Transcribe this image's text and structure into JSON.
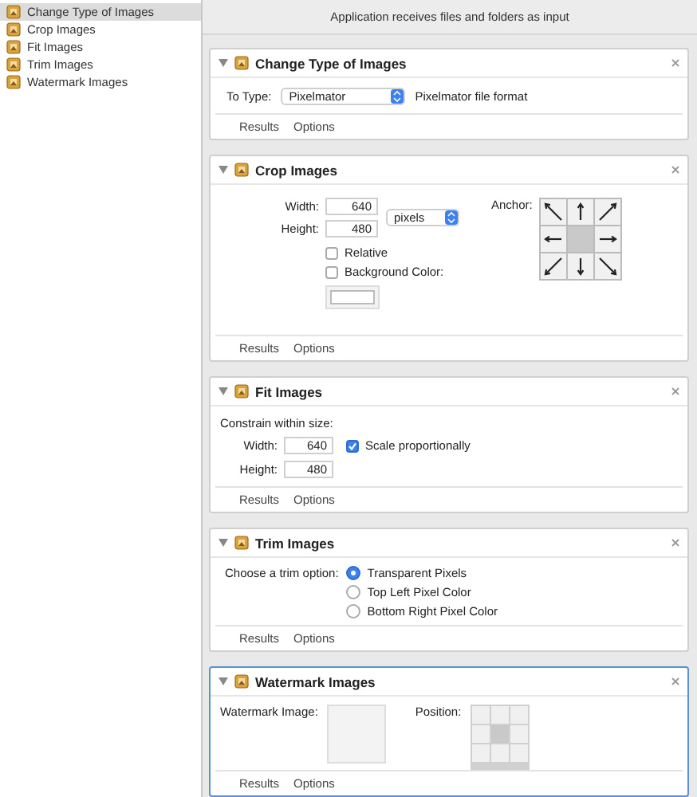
{
  "sidebar": {
    "items": [
      {
        "label": "Change Type of Images",
        "selected": true
      },
      {
        "label": "Crop Images",
        "selected": false
      },
      {
        "label": "Fit Images",
        "selected": false
      },
      {
        "label": "Trim Images",
        "selected": false
      },
      {
        "label": "Watermark Images",
        "selected": false
      }
    ]
  },
  "workflow_header": "Application receives files and folders as input",
  "actions": [
    {
      "kind": "change_type",
      "title": "Change Type of Images",
      "selected": false,
      "to_type_label": "To Type:",
      "to_type_value": "Pixelmator",
      "description": "Pixelmator file format",
      "footer_tabs": [
        "Results",
        "Options"
      ]
    },
    {
      "kind": "crop",
      "title": "Crop Images",
      "selected": false,
      "width_label": "Width:",
      "width_value": "640",
      "height_label": "Height:",
      "height_value": "480",
      "unit": "pixels",
      "checkboxes": [
        {
          "label": "Relative",
          "checked": false
        },
        {
          "label": "Background Color:",
          "checked": false
        }
      ],
      "anchor_label": "Anchor:",
      "anchor": [
        {
          "selected": false
        },
        {
          "selected": false
        },
        {
          "selected": false
        },
        {
          "selected": false
        },
        {
          "selected": true
        },
        {
          "selected": false
        },
        {
          "selected": false
        },
        {
          "selected": false
        },
        {
          "selected": false
        }
      ],
      "footer_tabs": [
        "Results",
        "Options"
      ]
    },
    {
      "kind": "fit",
      "title": "Fit Images",
      "selected": false,
      "constrain_label": "Constrain within size:",
      "width_label": "Width:",
      "width_value": "640",
      "height_label": "Height:",
      "height_value": "480",
      "scale_label": "Scale proportionally",
      "scale_checked": true,
      "footer_tabs": [
        "Results",
        "Options"
      ]
    },
    {
      "kind": "trim",
      "title": "Trim Images",
      "selected": false,
      "option_label": "Choose a trim option:",
      "options": [
        {
          "label": "Transparent Pixels",
          "selected": true
        },
        {
          "label": "Top Left Pixel Color",
          "selected": false
        },
        {
          "label": "Bottom Right Pixel Color",
          "selected": false
        }
      ],
      "footer_tabs": [
        "Results",
        "Options"
      ]
    },
    {
      "kind": "watermark",
      "title": "Watermark Images",
      "selected": true,
      "image_label": "Watermark Image:",
      "position_label": "Position:",
      "position": [
        {
          "selected": false
        },
        {
          "selected": false
        },
        {
          "selected": false
        },
        {
          "selected": false
        },
        {
          "selected": true
        },
        {
          "selected": false
        },
        {
          "selected": false
        },
        {
          "selected": false
        },
        {
          "selected": false
        }
      ],
      "footer_tabs": [
        "Results",
        "Options"
      ]
    }
  ]
}
